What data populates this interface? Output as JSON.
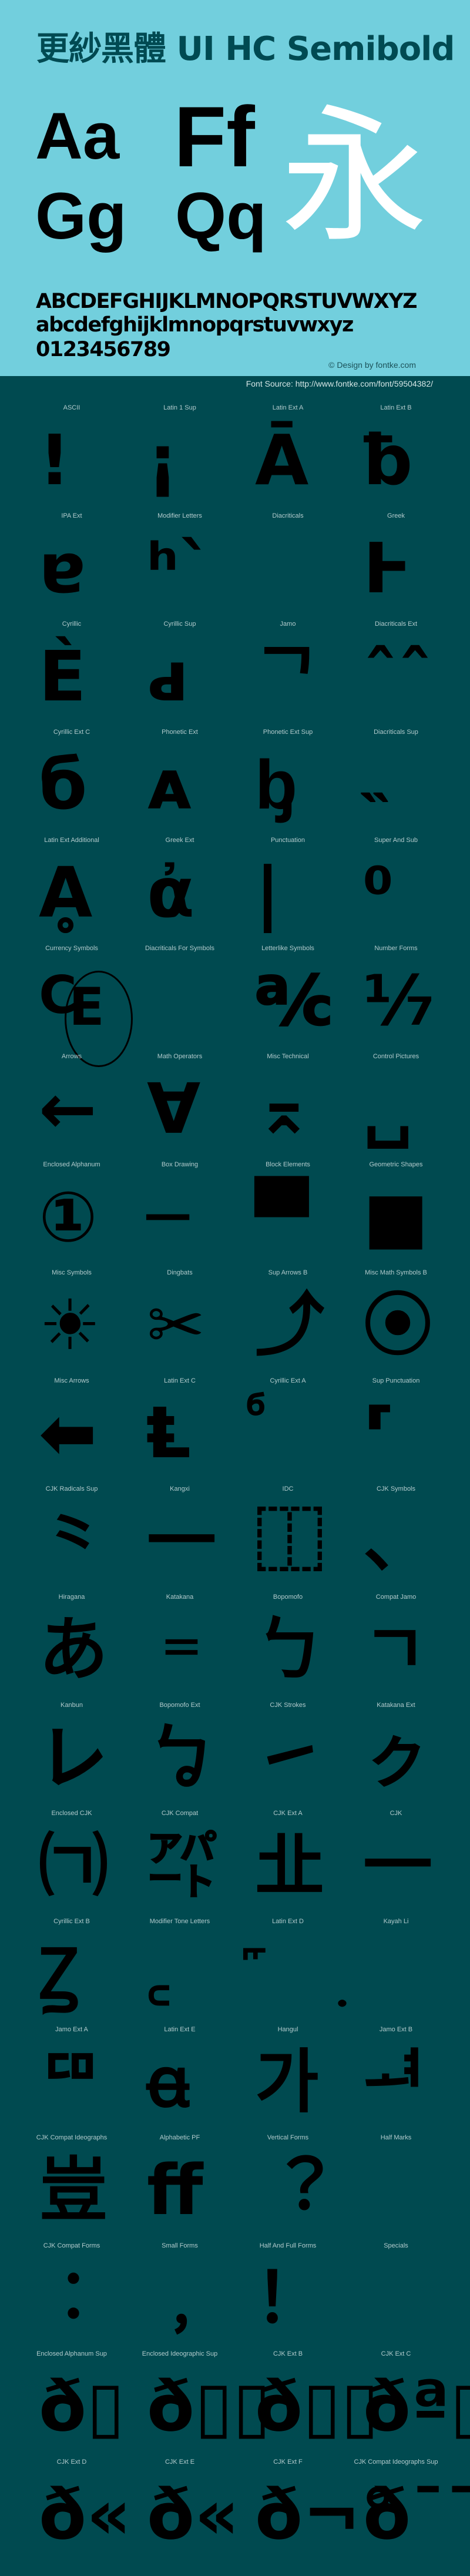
{
  "header": {
    "title": "更紗黑體 UI HC Semibold",
    "sample_aa": "Aa",
    "sample_gg": "Gg",
    "sample_ff": "Ff",
    "sample_qq": "Qq",
    "sample_cjk": "永",
    "uppercase": "ABCDEFGHIJKLMNOPQRSTUVWXYZ",
    "lowercase": "abcdefghijklmnopqrstuvwxyz",
    "digits": "0123456789",
    "credit": "© Design by fontke.com"
  },
  "source": "Font Source: http://www.fontke.com/font/59504382/",
  "colors": {
    "header_bg": "#72cfdd",
    "body_bg": "#004a50",
    "title": "#004a52",
    "label": "#b3cbcd"
  },
  "blocks": [
    {
      "label": "ASCII",
      "glyph": "!"
    },
    {
      "label": "Latin 1 Sup",
      "glyph": "¡"
    },
    {
      "label": "Latin Ext A",
      "glyph": "Ā"
    },
    {
      "label": "Latin Ext B",
      "glyph": "ƀ"
    },
    {
      "label": "IPA Ext",
      "glyph": "ɐ"
    },
    {
      "label": "Modifier Letters",
      "glyph": "ʰˋ"
    },
    {
      "label": "Diacriticals",
      "glyph": ""
    },
    {
      "label": "Greek",
      "glyph": "Ͱ"
    },
    {
      "label": "Cyrillic",
      "glyph": "Ѐ"
    },
    {
      "label": "Cyrillic Sup",
      "glyph": "ԁ"
    },
    {
      "label": "Jamo",
      "glyph": "ᄀ"
    },
    {
      "label": "Diacriticals Ext",
      "glyph": "ˆˆ"
    },
    {
      "label": "Cyrillic Ext C",
      "glyph": "б"
    },
    {
      "label": "Phonetic Ext",
      "glyph": "ᴀ"
    },
    {
      "label": "Phonetic Ext Sup",
      "glyph": "ᶀ"
    },
    {
      "label": "Diacriticals Sup",
      "glyph": "˵"
    },
    {
      "label": "Latin Ext Additional",
      "glyph": "Ḁ"
    },
    {
      "label": "Greek Ext",
      "glyph": "ἀ"
    },
    {
      "label": "Punctuation",
      "glyph": "|"
    },
    {
      "label": "Super And Sub",
      "glyph": "⁰"
    },
    {
      "label": "Currency Symbols",
      "glyph": "₠"
    },
    {
      "label": "Diacriticals For Symbols",
      "glyph": ""
    },
    {
      "label": "Letterlike Symbols",
      "glyph": "℀"
    },
    {
      "label": "Number Forms",
      "glyph": "⅐"
    },
    {
      "label": "Arrows",
      "glyph": "←"
    },
    {
      "label": "Math Operators",
      "glyph": "∀"
    },
    {
      "label": "Misc Technical",
      "glyph": "⌅"
    },
    {
      "label": "Control Pictures",
      "glyph": "␣"
    },
    {
      "label": "Enclosed Alphanum",
      "glyph": "①"
    },
    {
      "label": "Box Drawing",
      "glyph": "─"
    },
    {
      "label": "Block Elements",
      "glyph": "▀"
    },
    {
      "label": "Geometric Shapes",
      "glyph": "■"
    },
    {
      "label": "Misc Symbols",
      "glyph": "☀"
    },
    {
      "label": "Dingbats",
      "glyph": "✂"
    },
    {
      "label": "Sup Arrows B",
      "glyph": "⤴"
    },
    {
      "label": "Misc Math Symbols B",
      "glyph": "⦿"
    },
    {
      "label": "Misc Arrows",
      "glyph": "⬅"
    },
    {
      "label": "Latin Ext C",
      "glyph": "Ⱡ"
    },
    {
      "label": "Cyrillic Ext A",
      "glyph": "ⷠ"
    },
    {
      "label": "Sup Punctuation",
      "glyph": "⸢"
    },
    {
      "label": "CJK Radicals Sup",
      "glyph": "⺀"
    },
    {
      "label": "Kangxi",
      "glyph": "⼀"
    },
    {
      "label": "IDC",
      "glyph": "⿰"
    },
    {
      "label": "CJK Symbols",
      "glyph": "、"
    },
    {
      "label": "Hiragana",
      "glyph": "あ"
    },
    {
      "label": "Katakana",
      "glyph": "゠"
    },
    {
      "label": "Bopomofo",
      "glyph": "ㄅ"
    },
    {
      "label": "Compat Jamo",
      "glyph": "ㄱ"
    },
    {
      "label": "Kanbun",
      "glyph": "㆑"
    },
    {
      "label": "Bopomofo Ext",
      "glyph": "ㆠ"
    },
    {
      "label": "CJK Strokes",
      "glyph": "㇀"
    },
    {
      "label": "Katakana Ext",
      "glyph": "ㇰ"
    },
    {
      "label": "Enclosed CJK",
      "glyph": "㈀"
    },
    {
      "label": "CJK Compat",
      "glyph": "㌀"
    },
    {
      "label": "CJK Ext A",
      "glyph": "㐀"
    },
    {
      "label": "CJK",
      "glyph": "一"
    },
    {
      "label": "Cyrillic Ext B",
      "glyph": "Ꙁ"
    },
    {
      "label": "Modifier Tone Letters",
      "glyph": "꜀"
    },
    {
      "label": "Latin Ext D",
      "glyph": "꜠"
    },
    {
      "label": "Kayah Li",
      "glyph": "꤫"
    },
    {
      "label": "Jamo Ext A",
      "glyph": "ꥠ"
    },
    {
      "label": "Latin Ext E",
      "glyph": "ꬰ"
    },
    {
      "label": "Hangul",
      "glyph": "가"
    },
    {
      "label": "Jamo Ext B",
      "glyph": "ힰ"
    },
    {
      "label": "CJK Compat Ideographs",
      "glyph": "豈"
    },
    {
      "label": "Alphabetic PF",
      "glyph": "ﬀ"
    },
    {
      "label": "Vertical Forms",
      "glyph": "︖"
    },
    {
      "label": "Half Marks",
      "glyph": ""
    },
    {
      "label": "CJK Compat Forms",
      "glyph": "︰"
    },
    {
      "label": "Small Forms",
      "glyph": "﹐"
    },
    {
      "label": "Half And Full Forms",
      "glyph": "！"
    },
    {
      "label": "Specials",
      "glyph": "￼"
    },
    {
      "label": "Enclosed Alphanum Sup",
      "glyph": "ð▯"
    },
    {
      "label": "Enclosed Ideographic Sup",
      "glyph": "ð▯▯"
    },
    {
      "label": "CJK Ext B",
      "glyph": "ð▯▯"
    },
    {
      "label": "CJK Ext C",
      "glyph": "ðª▯"
    },
    {
      "label": "CJK Ext D",
      "glyph": "ð«"
    },
    {
      "label": "CJK Ext E",
      "glyph": "ð«"
    },
    {
      "label": "CJK Ext F",
      "glyph": "ð¬°"
    },
    {
      "label": "CJK Compat Ideographs Sup",
      "glyph": "ð¯¯"
    }
  ]
}
